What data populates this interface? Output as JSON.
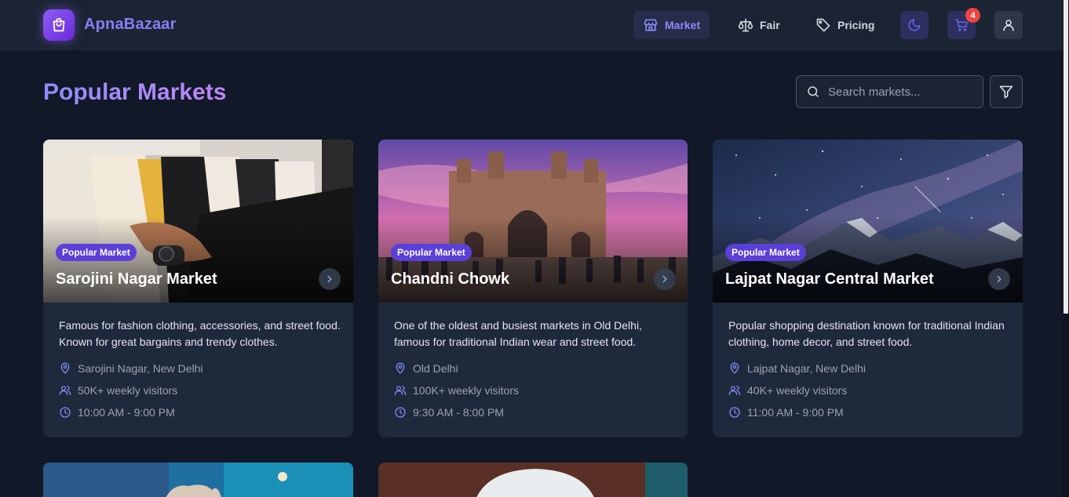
{
  "app": {
    "name": "ApnaBazaar"
  },
  "nav": {
    "items": [
      {
        "label": "Market",
        "icon": "store-icon",
        "active": true
      },
      {
        "label": "Fair",
        "icon": "scale-icon",
        "active": false
      },
      {
        "label": "Pricing",
        "icon": "tag-icon",
        "active": false
      }
    ],
    "cart_count": "4"
  },
  "page": {
    "title": "Popular Markets"
  },
  "search": {
    "placeholder": "Search markets..."
  },
  "markets": [
    {
      "badge": "Popular Market",
      "name": "Sarojini Nagar Market",
      "description": "Famous for fashion clothing, accessories, and street food. Known for great bargains and trendy clothes.",
      "location": "Sarojini Nagar, New Delhi",
      "visitors": "50K+ weekly visitors",
      "hours": "10:00 AM - 9:00 PM"
    },
    {
      "badge": "Popular Market",
      "name": "Chandni Chowk",
      "description": "One of the oldest and busiest markets in Old Delhi, famous for traditional Indian wear and street food.",
      "location": "Old Delhi",
      "visitors": "100K+ weekly visitors",
      "hours": "9:30 AM - 8:00 PM"
    },
    {
      "badge": "Popular Market",
      "name": "Lajpat Nagar Central Market",
      "description": "Popular shopping destination known for traditional Indian clothing, home decor, and street food.",
      "location": "Lajpat Nagar, New Delhi",
      "visitors": "40K+ weekly visitors",
      "hours": "11:00 AM - 9:00 PM"
    }
  ],
  "colors": {
    "accent": "#8b8cf8",
    "badge": "#5b3fd9",
    "cart_badge": "#ef4444",
    "background": "#111827",
    "card": "#1e293b"
  }
}
